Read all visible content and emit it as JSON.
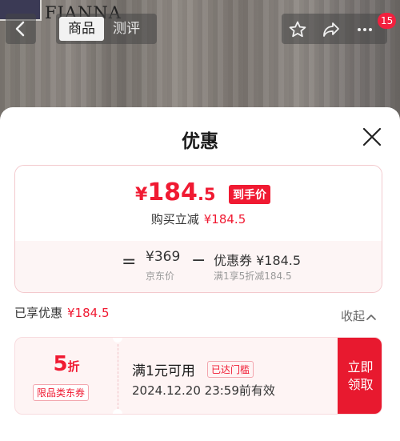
{
  "background": {
    "brand_logo_text": "FIANNA",
    "tabs": [
      {
        "label": "商品"
      },
      {
        "label": "测评"
      }
    ],
    "cart_badge": "15"
  },
  "sheet": {
    "title": "优惠",
    "price_card": {
      "currency": "¥",
      "final_price_int": "184",
      "final_price_dec": ".5",
      "final_tag": "到手价",
      "reduction_label": "购买立减",
      "reduction_amount": "¥184.5",
      "equals": "=",
      "original_price": "¥369",
      "original_label": "京东价",
      "minus": "−",
      "coupon_text": "优惠券 ¥184.5",
      "coupon_desc": "满1享5折减184.5"
    },
    "enjoyed_label": "已享优惠",
    "enjoyed_amount": "¥184.5",
    "collapse_label": "收起",
    "voucher": {
      "discount_num": "5",
      "discount_unit": "折",
      "scope": "限品类东券",
      "condition": "满1元可用",
      "threshold_tag": "已达门槛",
      "validity": "2024.12.20 23:59前有效",
      "claim_label_line1": "立即",
      "claim_label_line2": "领取"
    }
  },
  "colors": {
    "accent": "#f01a32",
    "claim_bg": "#e8192f"
  }
}
